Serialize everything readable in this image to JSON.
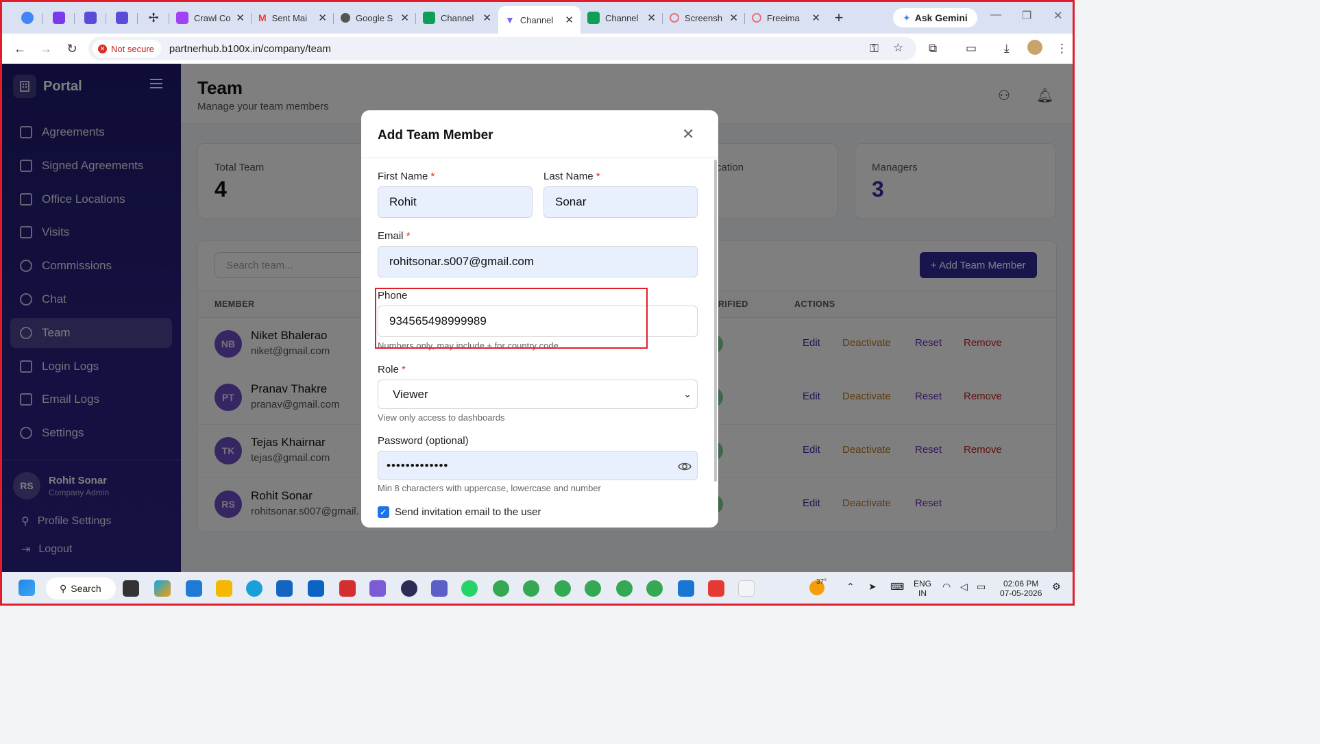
{
  "browser": {
    "tabs": [
      {
        "label": "Crawl Co",
        "fav_color": "#a142f4"
      },
      {
        "label": "Sent Mai",
        "fav_color": "#ea4335"
      },
      {
        "label": "Google S",
        "fav_color": "#555555"
      },
      {
        "label": "Channel",
        "fav_color": "#0f9d58"
      },
      {
        "label": "Channel",
        "fav_color": "#7b61ff",
        "active": true
      },
      {
        "label": "Channel",
        "fav_color": "#0f9d58"
      },
      {
        "label": "Screensh",
        "fav_color": "#e57373"
      },
      {
        "label": "Freeima",
        "fav_color": "#e57373"
      }
    ],
    "new_tab": "+",
    "gemini_label": "Ask Gemini",
    "security_label": "Not secure",
    "url": "partnerhub.b100x.in/company/team"
  },
  "sidebar": {
    "brand": "Portal",
    "items": [
      {
        "label": "Agreements"
      },
      {
        "label": "Signed Agreements"
      },
      {
        "label": "Office Locations"
      },
      {
        "label": "Visits"
      },
      {
        "label": "Commissions"
      },
      {
        "label": "Chat"
      },
      {
        "label": "Team",
        "active": true
      },
      {
        "label": "Login Logs"
      },
      {
        "label": "Email Logs"
      },
      {
        "label": "Settings"
      }
    ],
    "user": {
      "initials": "RS",
      "name": "Rohit Sonar",
      "role": "Company Admin"
    },
    "profile_settings": "Profile Settings",
    "logout": "Logout"
  },
  "page": {
    "title": "Team",
    "subtitle": "Manage your team members",
    "stats": [
      {
        "label": "Total Team",
        "value": "4"
      },
      {
        "label": "cation",
        "value": ""
      },
      {
        "label": "Managers",
        "value": "3"
      }
    ],
    "search_placeholder": "Search team...",
    "add_button": "+ Add Team Member",
    "columns": {
      "member": "MEMBER",
      "verified": "ERIFIED",
      "actions": "ACTIONS"
    },
    "members": [
      {
        "initials": "NB",
        "name": "Niket Bhalerao",
        "email": "niket@gmail.com",
        "actions": [
          "Edit",
          "Deactivate",
          "Reset",
          "Remove"
        ]
      },
      {
        "initials": "PT",
        "name": "Pranav Thakre",
        "email": "pranav@gmail.com",
        "actions": [
          "Edit",
          "Deactivate",
          "Reset",
          "Remove"
        ]
      },
      {
        "initials": "TK",
        "name": "Tejas Khairnar",
        "email": "tejas@gmail.com",
        "actions": [
          "Edit",
          "Deactivate",
          "Reset",
          "Remove"
        ]
      },
      {
        "initials": "RS",
        "name": "Rohit Sonar",
        "email": "rohitsonar.s007@gmail.",
        "actions": [
          "Edit",
          "Deactivate",
          "Reset"
        ]
      }
    ]
  },
  "modal": {
    "title": "Add Team Member",
    "first_name_label": "First Name",
    "first_name_value": "Rohit",
    "last_name_label": "Last Name",
    "last_name_value": "Sonar",
    "email_label": "Email",
    "email_value": "rohitsonar.s007@gmail.com",
    "phone_label": "Phone",
    "phone_value": "934565498999989",
    "phone_help": "Numbers only, may include + for country code",
    "role_label": "Role",
    "role_value": "Viewer",
    "role_help": "View only access to dashboards",
    "password_label": "Password (optional)",
    "password_value": "•••••••••••••",
    "password_help": "Min 8 characters with uppercase, lowercase and number",
    "invite_label": "Send invitation email to the user",
    "invite_checked": true,
    "required_mark": "*"
  },
  "taskbar": {
    "search_label": "Search",
    "weather": "37°",
    "lang_top": "ENG",
    "lang_bottom": "IN",
    "time": "02:06 PM",
    "date": "07-05-2026"
  }
}
